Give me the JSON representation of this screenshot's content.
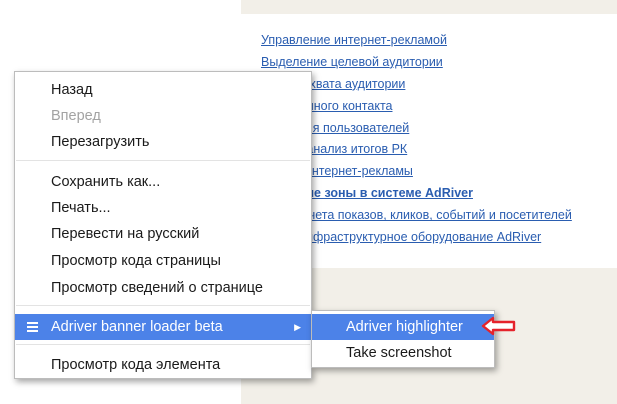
{
  "page_links": [
    {
      "text": "Управление интернет-рекламой",
      "bold": false
    },
    {
      "text": "Выделение целевой аудитории",
      "bold": false
    },
    {
      "text": "...ация охвата аудитории",
      "bold": false
    },
    {
      "text": "...рекламного контакта",
      "bold": false
    },
    {
      "text": "...ведения пользователей",
      "bold": false
    },
    {
      "text": "...имый анализ итогов РК",
      "bold": false
    },
    {
      "text": "...маты интернет-рекламы",
      "bold": false
    },
    {
      "text": "...ические зоны в системе AdRiver",
      "bold": true
    },
    {
      "text": "...а подсчета показов, кликов, событий и посетителей",
      "bold": false
    },
    {
      "text": "...ия и инфраструктурное оборудование AdRiver",
      "bold": false
    }
  ],
  "context_menu": {
    "back": "Назад",
    "forward": "Вперед",
    "reload": "Перезагрузить",
    "save_as": "Сохранить как...",
    "print": "Печать...",
    "translate": "Перевести на русский",
    "view_source": "Просмотр кода страницы",
    "page_info": "Просмотр  сведений о странице",
    "extension": "Adriver banner loader beta",
    "inspect": "Просмотр кода элемента"
  },
  "submenu": {
    "highlighter": "Adriver highlighter",
    "screenshot": "Take screenshot"
  },
  "colors": {
    "highlight": "#4c82e8",
    "link": "#2a5db0",
    "annotation_arrow": "#e5232b",
    "panel_bg": "#f2efe8"
  },
  "icons": {
    "extension_icon": "hamburger-menu-icon",
    "submenu_arrow": "chevron-right-icon",
    "annotation": "red-arrow-left-icon"
  }
}
